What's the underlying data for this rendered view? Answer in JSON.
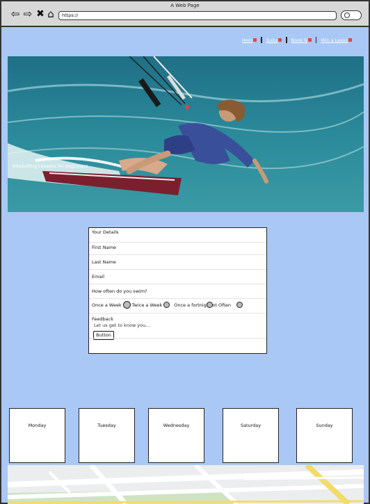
{
  "browser": {
    "title": "A Web Page",
    "url": "https://",
    "icons": [
      "back-arrow-icon",
      "forward-arrow-icon",
      "close-icon",
      "home-icon",
      "search-icon"
    ]
  },
  "nav": {
    "items": [
      {
        "label": "Hom"
      },
      {
        "label": "Suite"
      },
      {
        "label": "Book N"
      },
      {
        "label": "Win a Lesso"
      }
    ]
  },
  "hero": {
    "caption": "Kitesurfing Lessons for beginners"
  },
  "form": {
    "title": "Your Details",
    "first_name": "First Name",
    "last_name": "Last Name",
    "email": "Email",
    "question": "How often do you swim?",
    "options": [
      "Once a Week",
      "Twice a Week",
      "Once a fortnight",
      "ot Often"
    ],
    "feedback_label": "Feedback",
    "feedback_placeholder": "Let us get to know you...",
    "button": "Button"
  },
  "days": [
    "Monday",
    "Tuesday",
    "Wednesday",
    "Saturday",
    "Sunday"
  ],
  "colors": {
    "page_bg": "#a9c8f5",
    "chrome_bg": "#d8d8d8",
    "nav_marker": "#e04646"
  }
}
